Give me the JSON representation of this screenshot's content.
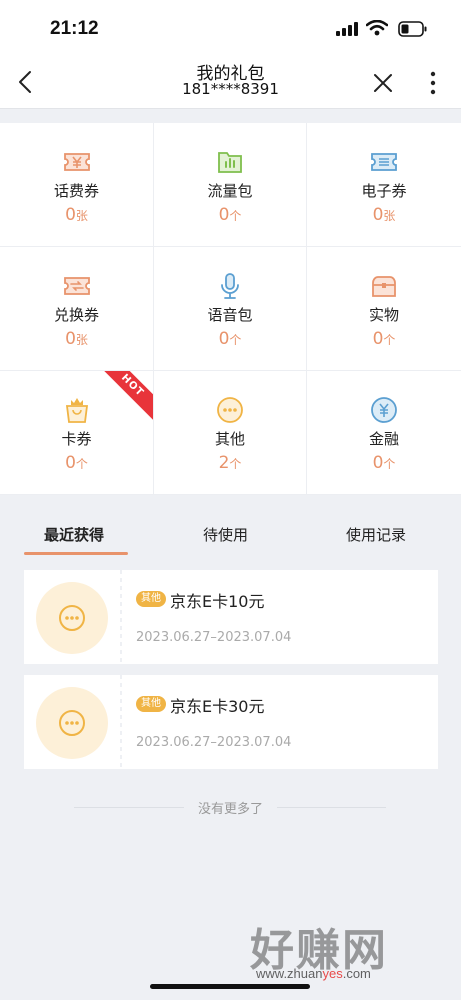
{
  "status_bar": {
    "time": "21:12"
  },
  "nav": {
    "title": "我的礼包",
    "subtitle": "181****8391"
  },
  "grid": [
    {
      "label": "话费券",
      "count": "0",
      "unit": "张",
      "icon": "ticket-yen-icon"
    },
    {
      "label": "流量包",
      "count": "0",
      "unit": "个",
      "icon": "data-bars-icon"
    },
    {
      "label": "电子券",
      "count": "0",
      "unit": "张",
      "icon": "e-coupon-icon"
    },
    {
      "label": "兑换券",
      "count": "0",
      "unit": "张",
      "icon": "exchange-ticket-icon"
    },
    {
      "label": "语音包",
      "count": "0",
      "unit": "个",
      "icon": "microphone-icon"
    },
    {
      "label": "实物",
      "count": "0",
      "unit": "个",
      "icon": "treasure-box-icon"
    },
    {
      "label": "卡券",
      "count": "0",
      "unit": "个",
      "icon": "gift-bag-icon",
      "badge": "HOT"
    },
    {
      "label": "其他",
      "count": "2",
      "unit": "个",
      "icon": "more-dots-icon"
    },
    {
      "label": "金融",
      "count": "0",
      "unit": "个",
      "icon": "yen-exchange-icon"
    }
  ],
  "tabs": [
    {
      "label": "最近获得",
      "active": true
    },
    {
      "label": "待使用",
      "active": false
    },
    {
      "label": "使用记录",
      "active": false
    }
  ],
  "cards": [
    {
      "tag": "其他",
      "name": "京东E卡10元",
      "date": "2023.06.27–2023.07.04"
    },
    {
      "tag": "其他",
      "name": "京东E卡30元",
      "date": "2023.06.27–2023.07.04"
    }
  ],
  "end_text": "没有更多了",
  "watermark": {
    "big": "好赚网",
    "small_a": "www.zhuan",
    "small_b": "yes",
    "small_c": ".com"
  },
  "colors": {
    "accent": "#e8936b",
    "tag": "#f0b445",
    "hot": "#e8343a",
    "background": "#eef0f4"
  }
}
